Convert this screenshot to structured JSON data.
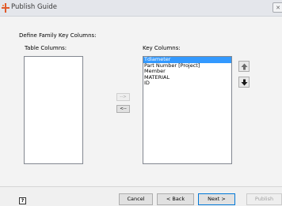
{
  "window": {
    "title": "Publish Guide"
  },
  "content": {
    "heading": "Define Family Key Columns:",
    "table_columns_label": "Table Columns:",
    "key_columns_label": "Key Columns:",
    "table_columns": [],
    "key_columns": [
      "Tdiameter",
      "Part Number [Project]",
      "Member",
      "MATERIAL",
      "ID"
    ],
    "selected_key_index": 0,
    "add_button": "-->",
    "remove_button": "<--"
  },
  "footer": {
    "help": "?",
    "cancel": "Cancel",
    "back": "< Back",
    "next": "Next >",
    "publish": "Publish"
  },
  "colors": {
    "selection": "#3399ff",
    "default_button_border": "#0078d7"
  }
}
